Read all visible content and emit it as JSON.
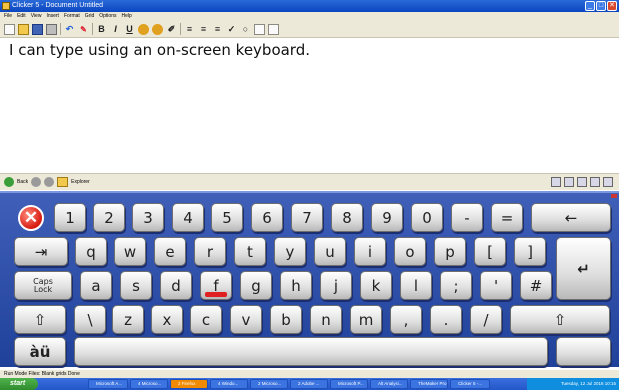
{
  "window": {
    "title": "Clicker 5 - Document Untitled"
  },
  "menu": [
    "File",
    "Edit",
    "View",
    "Insert",
    "Format",
    "Grid",
    "Options",
    "Help"
  ],
  "document": {
    "text": "I can type using an on-screen keyboard."
  },
  "explorer": {
    "back": "Back",
    "explorer_label": "Explorer"
  },
  "keyboard": {
    "row1": [
      "1",
      "2",
      "3",
      "4",
      "5",
      "6",
      "7",
      "8",
      "9",
      "0",
      "-",
      "=",
      "←"
    ],
    "row2": [
      "q",
      "w",
      "e",
      "r",
      "t",
      "y",
      "u",
      "i",
      "o",
      "p",
      "[",
      "]"
    ],
    "row3": [
      "a",
      "s",
      "d",
      "f",
      "g",
      "h",
      "j",
      "k",
      "l",
      ";",
      "'",
      "#"
    ],
    "row4": [
      "\\",
      "z",
      "x",
      "c",
      "v",
      "b",
      "n",
      "m",
      ",",
      ".",
      "/"
    ],
    "tab_label": "⇥",
    "caps_label_1": "Caps",
    "caps_label_2": "Lock",
    "shift_label": "⇧",
    "accent_label": "àü",
    "close_label": "✕",
    "enter_label": "↵",
    "highlighted_key": "f"
  },
  "status": {
    "text": "Run Mode   Files: Blank grids   Done"
  },
  "taskbar": {
    "start": "start",
    "tasks": [
      "Microsoft A...",
      "4 Microso...",
      "2 Firefox",
      "4 Windo...",
      "2 Microso...",
      "2 Adobe ...",
      "Microsoft P...",
      "Alt Analysi...",
      "TheMaker Pro",
      "Clicker 5 -..."
    ],
    "active_task": "2 Firefox",
    "clock": "Tuesday, 12 Jul 2016 10:16"
  }
}
